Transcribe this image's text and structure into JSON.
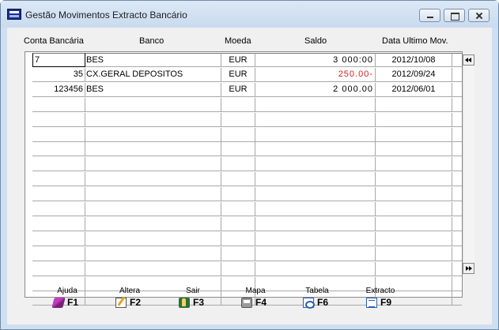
{
  "window": {
    "title": "Gestão Movimentos Extracto Bancário"
  },
  "columns": {
    "conta": "Conta Bancária",
    "banco": "Banco",
    "moeda": "Moeda",
    "saldo": "Saldo",
    "data": "Data Ultimo Mov."
  },
  "rows": [
    {
      "conta": "7",
      "banco": "BES",
      "moeda": "EUR",
      "saldo": "3 000:00",
      "data": "2012/10/08",
      "negative": false
    },
    {
      "conta": "35",
      "banco": "CX.GERAL DEPOSITOS",
      "moeda": "EUR",
      "saldo": "250.00-",
      "data": "2012/09/24",
      "negative": true
    },
    {
      "conta": "123456",
      "banco": "BES",
      "moeda": "EUR",
      "saldo": "2 000.00",
      "data": "2012/06/01",
      "negative": false
    }
  ],
  "empty_row_count": 14,
  "function_keys": [
    {
      "label": "Ajuda",
      "key": "F1",
      "icon": "help-book-icon"
    },
    {
      "label": "Altera",
      "key": "F2",
      "icon": "edit-pencil-icon"
    },
    {
      "label": "Sair",
      "key": "F3",
      "icon": "exit-door-icon"
    },
    {
      "label": "Mapa",
      "key": "F4",
      "icon": "printer-icon"
    },
    {
      "label": "Tabela",
      "key": "F6",
      "icon": "table-search-icon"
    },
    {
      "label": "Extracto",
      "key": "F9",
      "icon": "document-icon"
    }
  ],
  "colors": {
    "negative": "#d42020",
    "window_frame": "#cfdff0"
  }
}
